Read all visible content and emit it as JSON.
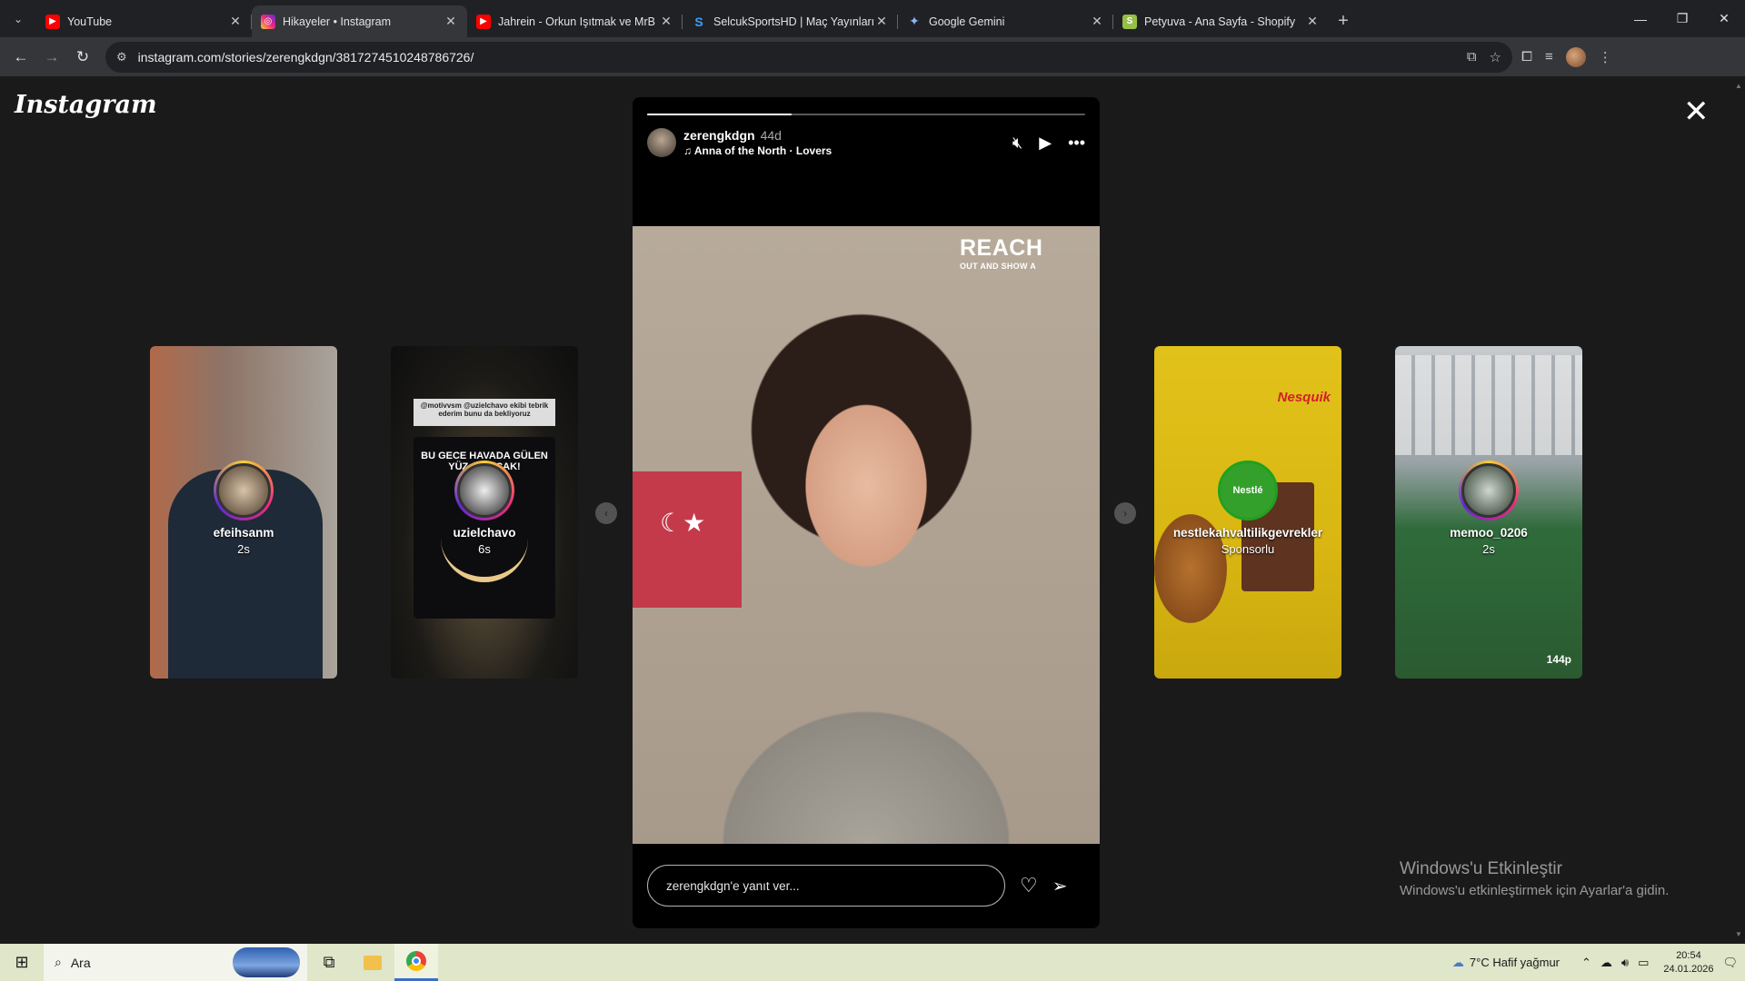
{
  "browser": {
    "tabs": [
      {
        "title": "YouTube",
        "icon": "youtube-icon",
        "color": "#ff0000",
        "active": false
      },
      {
        "title": "Hikayeler • Instagram",
        "icon": "instagram-icon",
        "color": "#e1306c",
        "active": true
      },
      {
        "title": "Jahrein - Orkun Işıtmak ve MrB",
        "icon": "youtube-icon",
        "color": "#ff0000",
        "active": false
      },
      {
        "title": "SelcukSportsHD | Maç Yayınları",
        "icon": "selcuk-icon",
        "color": "#3aa0ff",
        "active": false
      },
      {
        "title": "Google Gemini",
        "icon": "gemini-icon",
        "color": "#8ab4f8",
        "active": false
      },
      {
        "title": "Petyuva - Ana Sayfa - Shopify",
        "icon": "shopify-icon",
        "color": "#95bf47",
        "active": false
      }
    ],
    "url": "instagram.com/stories/zerengkdgn/3817274510248786726/"
  },
  "instagram": {
    "logo": "Instagram",
    "story": {
      "username": "zerengkdgn",
      "age": "44d",
      "music": "Anna of the North · Lovers",
      "progress": 0.33,
      "overlay_big": "REACH",
      "overlay_small": "OUT AND SHOW A",
      "reply_placeholder": "zerengkdgn'e yanıt ver..."
    },
    "previews": [
      {
        "username": "efeihsanm",
        "sub": "2s"
      },
      {
        "username": "uzielchavo",
        "sub": "6s",
        "caption": "@motivvsm @uzielchavo ekibi tebrik ederim bunu da bekliyoruz",
        "headline": "BU GECE HAVADA GÜLEN YÜZ ÇIKACAK!"
      },
      {
        "username": "nestlekahvaltilikgevrekler",
        "sub": "Sponsorlu",
        "brand": "Nesquik",
        "badge": "Nestlé"
      },
      {
        "username": "memoo_0206",
        "sub": "2s",
        "corner": "144p"
      }
    ],
    "activate": {
      "title": "Windows'u Etkinleştir",
      "subtitle": "Windows'u etkinleştirmek için Ayarlar'a gidin."
    }
  },
  "taskbar": {
    "search_placeholder": "Ara",
    "weather": "7°C  Hafif yağmur",
    "time": "20:54",
    "date": "24.01.2026"
  }
}
